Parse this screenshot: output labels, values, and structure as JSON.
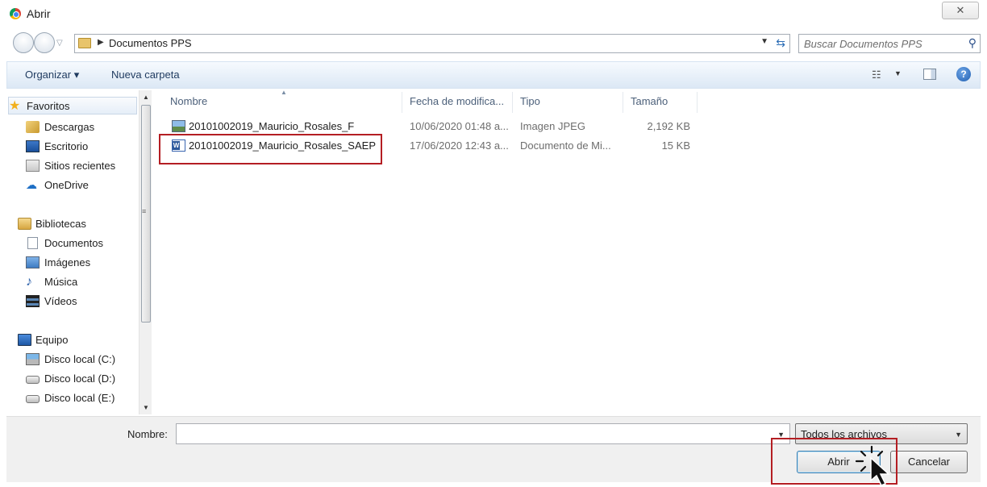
{
  "window": {
    "title": "Abrir",
    "close_symbol": "✕"
  },
  "address": {
    "path": [
      "Documentos PPS"
    ],
    "search_placeholder": "Buscar Documentos PPS"
  },
  "toolbar": {
    "organize_label": "Organizar ▾",
    "new_folder_label": "Nueva carpeta"
  },
  "sidebar": {
    "favorites": {
      "label": "Favoritos",
      "items": [
        "Descargas",
        "Escritorio",
        "Sitios recientes",
        "OneDrive"
      ]
    },
    "libraries": {
      "label": "Bibliotecas",
      "items": [
        "Documentos",
        "Imágenes",
        "Música",
        "Vídeos"
      ]
    },
    "computer": {
      "label": "Equipo",
      "items": [
        "Disco local (C:)",
        "Disco local (D:)",
        "Disco local (E:)"
      ]
    }
  },
  "file_list": {
    "columns": [
      "Nombre",
      "Fecha de modifica...",
      "Tipo",
      "Tamaño"
    ],
    "rows": [
      {
        "name": "20101002019_Mauricio_Rosales_F",
        "date": "10/06/2020 01:48 a...",
        "type": "Imagen JPEG",
        "size": "2,192 KB",
        "icon": "image-file-icon"
      },
      {
        "name": "20101002019_Mauricio_Rosales_SAEP",
        "date": "17/06/2020 12:43 a...",
        "type": "Documento de Mi...",
        "size": "15 KB",
        "icon": "word-document-icon",
        "highlighted": true
      }
    ]
  },
  "footer": {
    "filename_label": "Nombre:",
    "filename_value": "",
    "filter_value": "Todos los archivos",
    "open_button": "Abrir",
    "cancel_button": "Cancelar"
  },
  "colors": {
    "highlight": "#b41e23",
    "toolbar_bg": "#dce8f5",
    "header_text": "#4c607a"
  }
}
